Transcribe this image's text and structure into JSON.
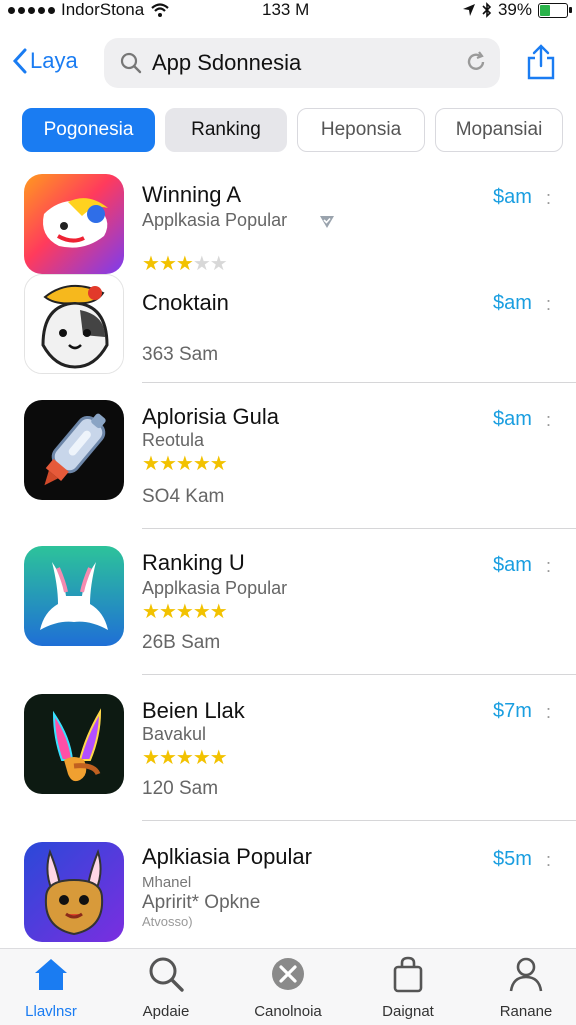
{
  "status": {
    "carrier": "IndorStona",
    "time": "133 M",
    "battery": "39%",
    "battery_level": 0.39
  },
  "nav": {
    "back_label": "Laya",
    "search_query": "App Sdonnesia"
  },
  "tabs": [
    {
      "label": "Pogonesia"
    },
    {
      "label": "Ranking"
    },
    {
      "label": "Heponsia"
    },
    {
      "label": "Mopansiai"
    }
  ],
  "apps": [
    {
      "title": "Winning A",
      "subtitle": "Applkasia Popular",
      "rating": 3,
      "price": "$am",
      "more": ":"
    },
    {
      "title": "Cnoktain",
      "meta": "363 Sam",
      "price": "$am",
      "more": ":"
    },
    {
      "title": "Aplorisia Gula",
      "subtitle": "Reotula",
      "rating": 5,
      "meta": "SO4 Kam",
      "price": "$am",
      "more": ":"
    },
    {
      "title": "Ranking U",
      "subtitle": "Applkasia Popular",
      "rating": 5,
      "meta": "26B Sam",
      "price": "$am",
      "more": ":"
    },
    {
      "title": "Beien Llak",
      "subtitle": "Bavakul",
      "rating": 5,
      "meta": "120 Sam",
      "price": "$7m",
      "more": ":"
    },
    {
      "title": "Aplkiasia Popular",
      "subtitle": "Mhanel",
      "meta": "Apririt* Opkne",
      "meta2": "Atvosso)",
      "price": "$5m",
      "more": ":"
    }
  ],
  "tabbar": [
    {
      "label": "Llavlnsr",
      "icon": "home-icon"
    },
    {
      "label": "Apdaie",
      "icon": "search-icon"
    },
    {
      "label": "Canolnoia",
      "icon": "games-icon"
    },
    {
      "label": "Daignat",
      "icon": "bag-icon"
    },
    {
      "label": "Ranane",
      "icon": "profile-icon"
    }
  ],
  "colors": {
    "accent": "#1a7cf2",
    "price": "#1a9ee0",
    "star": "#f2c200"
  }
}
